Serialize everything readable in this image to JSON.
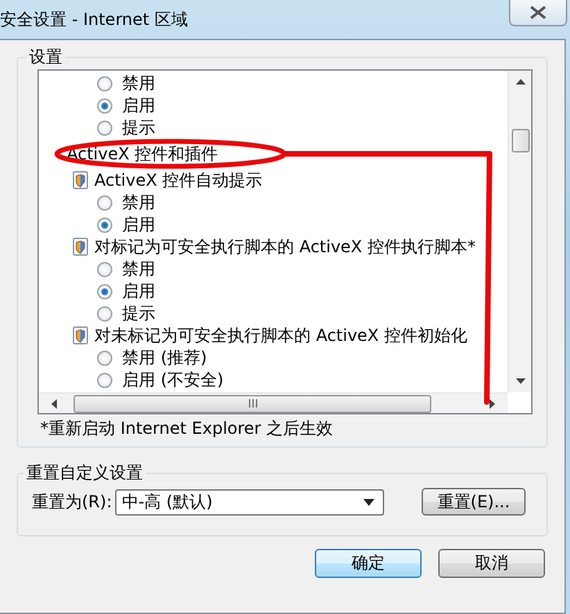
{
  "window": {
    "title": "安全设置 - Internet 区域"
  },
  "settings": {
    "title": "设置",
    "options_above": [
      {
        "label": "禁用",
        "selected": false
      },
      {
        "label": "启用",
        "selected": true
      },
      {
        "label": "提示",
        "selected": false
      }
    ],
    "groups": [
      {
        "label": "ActiveX 控件和插件",
        "children": [
          {
            "label": "ActiveX 控件自动提示",
            "children": [
              {
                "label": "禁用",
                "selected": false
              },
              {
                "label": "启用",
                "selected": true
              }
            ]
          },
          {
            "label": "对标记为可安全执行脚本的 ActiveX 控件执行脚本*",
            "children": [
              {
                "label": "禁用",
                "selected": false
              },
              {
                "label": "启用",
                "selected": true
              },
              {
                "label": "提示",
                "selected": false
              }
            ]
          },
          {
            "label": "对未标记为可安全执行脚本的 ActiveX 控件初始化",
            "children": [
              {
                "label": "禁用 (推荐)",
                "selected": false
              },
              {
                "label": "启用 (不安全)",
                "selected": false
              }
            ]
          }
        ]
      }
    ],
    "note": "*重新启动 Internet Explorer 之后生效"
  },
  "reset": {
    "title": "重置自定义设置",
    "label": "重置为(R):",
    "value": "中-高 (默认)",
    "button": "重置(E)..."
  },
  "buttons": [
    "确定",
    "取消"
  ]
}
